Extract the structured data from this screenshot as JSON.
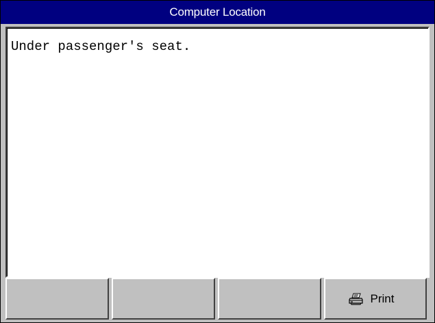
{
  "window": {
    "title": "Computer Location"
  },
  "content": {
    "text": "Under passenger's seat."
  },
  "softkeys": [
    {
      "label": ""
    },
    {
      "label": ""
    },
    {
      "label": ""
    },
    {
      "label": "Print",
      "icon": "printer-icon"
    }
  ],
  "colors": {
    "title_bar": "#000080",
    "title_text": "#ffffff",
    "panel": "#c0c0c0",
    "content_bg": "#ffffff"
  }
}
